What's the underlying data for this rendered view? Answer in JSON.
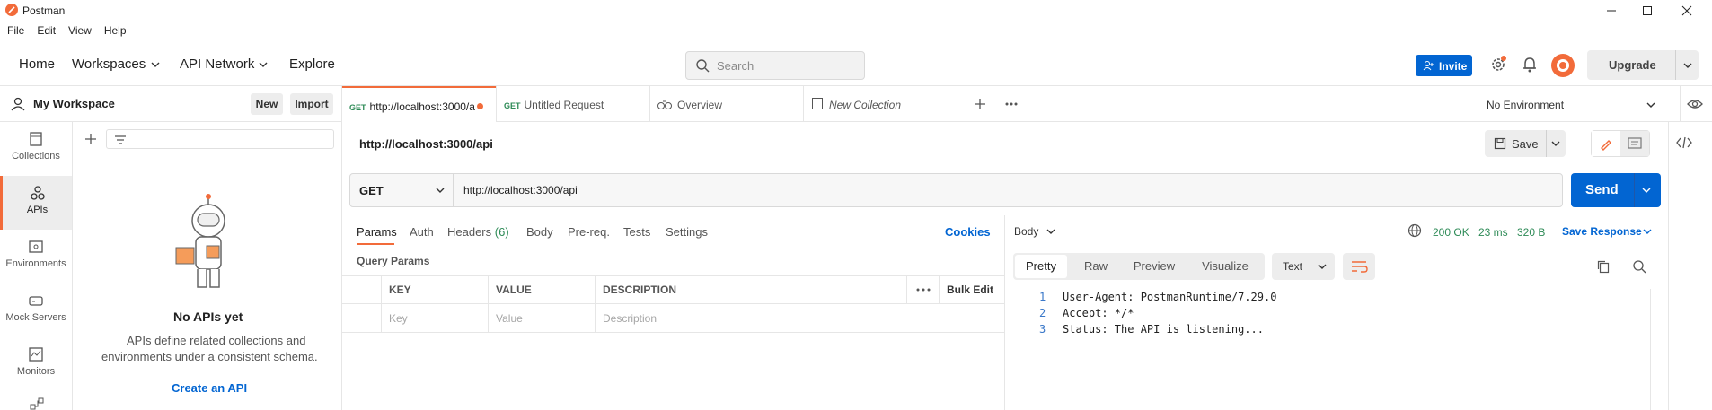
{
  "titlebar": {
    "title": "Postman"
  },
  "menu": [
    "File",
    "Edit",
    "View",
    "Help"
  ],
  "header": {
    "nav": [
      "Home",
      "Workspaces",
      "API Network",
      "Explore"
    ],
    "search_placeholder": "Search",
    "invite_label": "Invite",
    "upgrade_label": "Upgrade"
  },
  "sidebar": {
    "workspace_name": "My Workspace",
    "new_label": "New",
    "import_label": "Import",
    "rail": [
      {
        "label": "Collections",
        "icon": "collections-icon"
      },
      {
        "label": "APIs",
        "icon": "apis-icon"
      },
      {
        "label": "Environments",
        "icon": "environments-icon"
      },
      {
        "label": "Mock Servers",
        "icon": "mock-servers-icon"
      },
      {
        "label": "Monitors",
        "icon": "monitors-icon"
      }
    ],
    "empty_title": "No APIs yet",
    "empty_text_1": "APIs define related collections and",
    "empty_text_2": "environments under a consistent schema.",
    "create_link": "Create an API"
  },
  "tabs": [
    {
      "method": "GET",
      "label": "http://localhost:3000/a"
    },
    {
      "method": "GET",
      "label": "Untitled Request"
    },
    {
      "label": "Overview"
    },
    {
      "label": "New Collection"
    }
  ],
  "environment": "No Environment",
  "request": {
    "title": "http://localhost:3000/api",
    "save_label": "Save",
    "method": "GET",
    "url": "http://localhost:3000/api",
    "send_label": "Send",
    "tabs": [
      "Params",
      "Auth",
      "Headers",
      "(6)",
      "Body",
      "Pre-req.",
      "Tests",
      "Settings"
    ],
    "cookies_label": "Cookies",
    "query_params_label": "Query Params",
    "columns": [
      "KEY",
      "VALUE",
      "DESCRIPTION"
    ],
    "bulk_edit_label": "Bulk Edit",
    "placeholders": {
      "key": "Key",
      "value": "Value",
      "description": "Description"
    }
  },
  "response": {
    "body_label": "Body",
    "status": "200 OK",
    "time": "23 ms",
    "size": "320 B",
    "save_response_label": "Save Response",
    "view_tabs": [
      "Pretty",
      "Raw",
      "Preview",
      "Visualize"
    ],
    "format": "Text",
    "lines": [
      {
        "n": "1",
        "text": "User-Agent: PostmanRuntime/7.29.0"
      },
      {
        "n": "2",
        "text": "Accept: */*"
      },
      {
        "n": "3",
        "text": "Status: The API is listening..."
      }
    ]
  },
  "colors": {
    "accent": "#0265d2",
    "brand": "#f26b3a",
    "success": "#2e8b57"
  }
}
